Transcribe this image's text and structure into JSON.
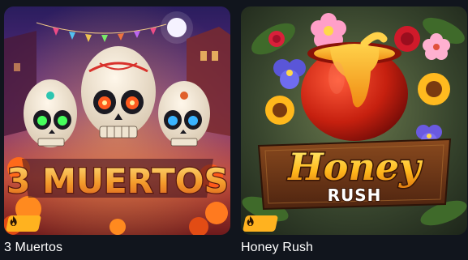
{
  "games": [
    {
      "title": "3 Muertos",
      "logo_text": "3 MUERTOS",
      "badge_icon": "flame-icon",
      "colors": {
        "primary": "#d9682b",
        "badge": "#ffb21f"
      }
    },
    {
      "title": "Honey Rush",
      "logo_text_top": "Honey",
      "logo_text_bottom": "RUSH",
      "badge_icon": "flame-icon",
      "colors": {
        "primary": "#b51f14",
        "badge": "#ffb21f"
      }
    }
  ]
}
